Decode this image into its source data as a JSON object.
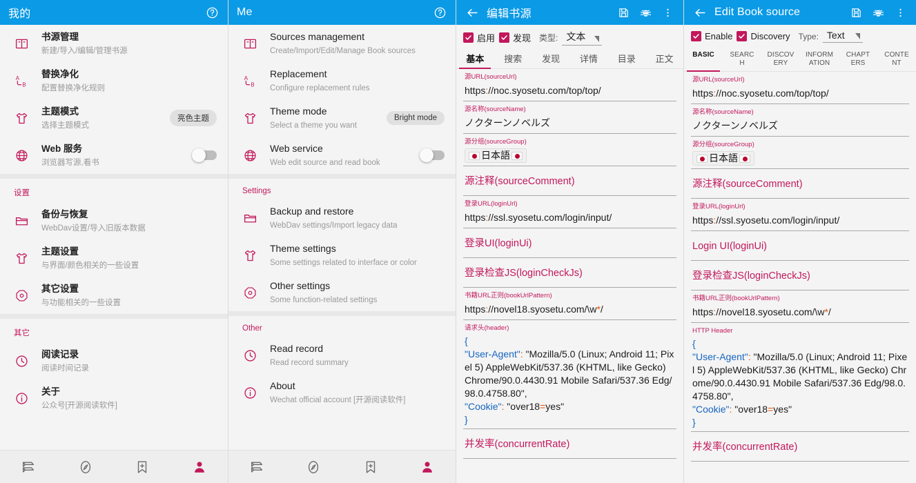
{
  "colors": {
    "appbar": "#0b9ae6",
    "accent": "#c2185b",
    "background": "#f4f4f4",
    "nav_active": "#c2185b"
  },
  "panel_me_zh": {
    "appbar": {
      "title": "我的",
      "help_icon": "help-circle-icon"
    },
    "groups": [
      {
        "title": "",
        "items": [
          {
            "icon": "book-open-icon",
            "title": "书源管理",
            "subtitle": "新建/导入/编辑/管理书源",
            "trailing": ""
          },
          {
            "icon": "replace-ab-icon",
            "title": "替换净化",
            "subtitle": "配置替换净化规则",
            "trailing": ""
          },
          {
            "icon": "shirt-icon",
            "title": "主题模式",
            "subtitle": "选择主题模式",
            "trailing": "chip",
            "chip": "亮色主题"
          },
          {
            "icon": "globe-icon",
            "title": "Web 服务",
            "subtitle": "浏览器写源,看书",
            "trailing": "toggle",
            "toggle_on": false
          }
        ]
      },
      {
        "title": "设置",
        "items": [
          {
            "icon": "folder-icon",
            "title": "备份与恢复",
            "subtitle": "WebDav设置/导入旧版本数据",
            "trailing": ""
          },
          {
            "icon": "shirt-icon",
            "title": "主题设置",
            "subtitle": "与界面/颜色相关的一些设置",
            "trailing": ""
          },
          {
            "icon": "gear-octagon-icon",
            "title": "其它设置",
            "subtitle": "与功能相关的一些设置",
            "trailing": ""
          }
        ]
      },
      {
        "title": "其它",
        "items": [
          {
            "icon": "clock-icon",
            "title": "阅读记录",
            "subtitle": "阅读时间记录",
            "trailing": ""
          },
          {
            "icon": "info-icon",
            "title": "关于",
            "subtitle": "公众号[开源阅读软件]",
            "trailing": ""
          }
        ]
      }
    ],
    "bottom_nav": [
      {
        "icon": "bookshelf-icon",
        "active": false
      },
      {
        "icon": "compass-icon",
        "active": false
      },
      {
        "icon": "bookmark-plus-icon",
        "active": false
      },
      {
        "icon": "person-icon",
        "active": true
      }
    ]
  },
  "panel_me_en": {
    "appbar": {
      "title": "Me",
      "help_icon": "help-circle-icon"
    },
    "groups": [
      {
        "title": "",
        "items": [
          {
            "icon": "book-open-icon",
            "title": "Sources management",
            "subtitle": "Create/Import/Edit/Manage Book sources",
            "trailing": ""
          },
          {
            "icon": "replace-ab-icon",
            "title": "Replacement",
            "subtitle": "Configure replacement rules",
            "trailing": ""
          },
          {
            "icon": "shirt-icon",
            "title": "Theme mode",
            "subtitle": "Select a theme you want",
            "trailing": "chip",
            "chip": "Bright mode"
          },
          {
            "icon": "globe-icon",
            "title": "Web service",
            "subtitle": "Web edit source and read book",
            "trailing": "toggle",
            "toggle_on": false
          }
        ]
      },
      {
        "title": "Settings",
        "items": [
          {
            "icon": "folder-icon",
            "title": "Backup and restore",
            "subtitle": "WebDav settings/Import legacy data",
            "trailing": ""
          },
          {
            "icon": "shirt-icon",
            "title": "Theme settings",
            "subtitle": "Some settings related to interface or color",
            "trailing": ""
          },
          {
            "icon": "gear-octagon-icon",
            "title": "Other settings",
            "subtitle": "Some function-related settings",
            "trailing": ""
          }
        ]
      },
      {
        "title": "Other",
        "items": [
          {
            "icon": "clock-icon",
            "title": "Read record",
            "subtitle": "Read record summary",
            "trailing": ""
          },
          {
            "icon": "info-icon",
            "title": "About",
            "subtitle": "Wechat official account [开源阅读软件]",
            "trailing": ""
          }
        ]
      }
    ],
    "bottom_nav": [
      {
        "icon": "bookshelf-icon",
        "active": false
      },
      {
        "icon": "compass-icon",
        "active": false
      },
      {
        "icon": "bookmark-plus-icon",
        "active": false
      },
      {
        "icon": "person-icon",
        "active": true
      }
    ]
  },
  "panel_editor_zh": {
    "appbar": {
      "back_icon": "arrow-left-icon",
      "title": "编辑书源",
      "save_icon": "save-floppy-icon",
      "debug_icon": "bug-icon",
      "more_icon": "more-vertical-icon"
    },
    "options": {
      "enable_label": "启用",
      "enable_checked": true,
      "discovery_label": "发现",
      "discovery_checked": true,
      "type_label": "类型:",
      "type_value": "文本"
    },
    "tabs": [
      {
        "label": "基本",
        "active": true
      },
      {
        "label": "搜索",
        "active": false
      },
      {
        "label": "发现",
        "active": false
      },
      {
        "label": "详情",
        "active": false
      },
      {
        "label": "目录",
        "active": false
      },
      {
        "label": "正文",
        "active": false
      }
    ],
    "fields": [
      {
        "label": "源URL(sourceUrl)",
        "label_size": "small",
        "value": "https://noc.syosetu.com/top/top/",
        "kind": "url"
      },
      {
        "label": "源名称(sourceName)",
        "label_size": "small",
        "value": "ノクターンノベルズ",
        "kind": "text"
      },
      {
        "label": "源分组(sourceGroup)",
        "label_size": "small",
        "value": "日本語",
        "kind": "flagchip"
      },
      {
        "label": "源注释(sourceComment)",
        "label_size": "big",
        "value": "",
        "kind": "empty"
      },
      {
        "label": "登录URL(loginUrl)",
        "label_size": "small",
        "value": "https://ssl.syosetu.com/login/input/",
        "kind": "url"
      },
      {
        "label": "登录UI(loginUi)",
        "label_size": "big",
        "value": "",
        "kind": "empty"
      },
      {
        "label": "登录检查JS(loginCheckJs)",
        "label_size": "big",
        "value": "",
        "kind": "empty"
      },
      {
        "label": "书籍URL正则(bookUrlPattern)",
        "label_size": "small",
        "value": "https://novel18.syosetu.com/\\w*/",
        "kind": "regex"
      },
      {
        "label": "请求头(header)",
        "label_size": "small",
        "value": "header-json",
        "kind": "json"
      },
      {
        "label": "并发率(concurrentRate)",
        "label_size": "big",
        "value": "",
        "kind": "empty"
      }
    ],
    "header_json": {
      "open_brace": "{",
      "line1_key": "\"User-Agent\"",
      "line1_colon": ": ",
      "line1_value": "\"Mozilla/5.0 (Linux; Android 11; Pixel 5) AppleWebKit/537.36 (KHTML, like Gecko) Chrome/90.0.4430.91 Mobile Safari/537.36 Edg/98.0.4758.80\",",
      "line2_key": "\"Cookie\"",
      "line2_colon": ": ",
      "line2_value": "\"over18=yes\"",
      "close_brace": "}"
    }
  },
  "panel_editor_en": {
    "appbar": {
      "back_icon": "arrow-left-icon",
      "title": "Edit Book source",
      "save_icon": "save-floppy-icon",
      "debug_icon": "bug-icon",
      "more_icon": "more-vertical-icon"
    },
    "options": {
      "enable_label": "Enable",
      "enable_checked": true,
      "discovery_label": "Discovery",
      "discovery_checked": true,
      "type_label": "Type:",
      "type_value": "Text"
    },
    "tabs": [
      {
        "label": "BASIC",
        "active": true
      },
      {
        "label": "SEARC H",
        "active": false
      },
      {
        "label": "DISCOV ERY",
        "active": false
      },
      {
        "label": "INFORM ATION",
        "active": false
      },
      {
        "label": "CHAPT ERS",
        "active": false
      },
      {
        "label": "CONTE NT",
        "active": false
      }
    ],
    "fields": [
      {
        "label": "源URL(sourceUrl)",
        "label_size": "small",
        "value": "https://noc.syosetu.com/top/top/",
        "kind": "url"
      },
      {
        "label": "源名称(sourceName)",
        "label_size": "small",
        "value": "ノクターンノベルズ",
        "kind": "text"
      },
      {
        "label": "源分组(sourceGroup)",
        "label_size": "small",
        "value": "日本語",
        "kind": "flagchip"
      },
      {
        "label": "源注释(sourceComment)",
        "label_size": "big",
        "value": "",
        "kind": "empty"
      },
      {
        "label": "登录URL(loginUrl)",
        "label_size": "small",
        "value": "https://ssl.syosetu.com/login/input/",
        "kind": "url"
      },
      {
        "label": "Login UI(loginUi)",
        "label_size": "big",
        "value": "",
        "kind": "empty"
      },
      {
        "label": "登录检查JS(loginCheckJs)",
        "label_size": "big",
        "value": "",
        "kind": "empty"
      },
      {
        "label": "书籍URL正则(bookUrlPattern)",
        "label_size": "small",
        "value": "https://novel18.syosetu.com/\\w*/",
        "kind": "regex"
      },
      {
        "label": "HTTP Header",
        "label_size": "small",
        "value": "header-json",
        "kind": "json"
      },
      {
        "label": "并发率(concurrentRate)",
        "label_size": "big",
        "value": "",
        "kind": "empty"
      }
    ],
    "header_json": {
      "open_brace": "{",
      "line1_key": "\"User-Agent\"",
      "line1_colon": ": ",
      "line1_value": "\"Mozilla/5.0 (Linux; Android 11; Pixel 5) AppleWebKit/537.36 (KHTML, like Gecko) Chrome/90.0.4430.91 Mobile Safari/537.36 Edg/98.0.4758.80\",",
      "line2_key": "\"Cookie\"",
      "line2_colon": ": ",
      "line2_value": "\"over18=yes\"",
      "close_brace": "}"
    }
  }
}
